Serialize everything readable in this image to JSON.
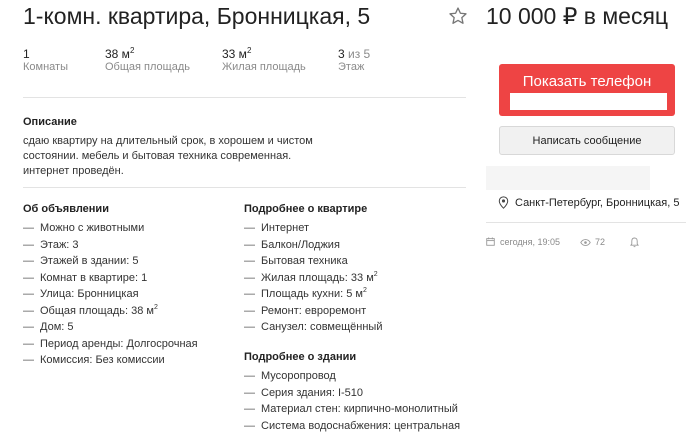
{
  "listing": {
    "title": "1-комн. квартира, Бронницкая, 5",
    "price": "10 000 ₽ в месяц"
  },
  "stats": [
    {
      "value": "1",
      "sup": "",
      "label": "Комнаты"
    },
    {
      "value": "38 м",
      "sup": "2",
      "label": "Общая площадь"
    },
    {
      "value": "33 м",
      "sup": "2",
      "label": "Жилая площадь"
    },
    {
      "value": "3",
      "value_suffix": " из 5",
      "label": "Этаж"
    }
  ],
  "description": {
    "heading": "Описание",
    "text": "сдаю квартиру на длительный срок, в хорошем и чистом состоянии. мебель и бытовая техника современная. интернет проведён."
  },
  "about_ad": {
    "heading": "Об объявлении",
    "items": [
      "Можно с животными",
      "Этаж: 3",
      "Этажей в здании: 5",
      "Комнат в квартире: 1",
      "Улица: Бронницкая",
      "Общая площадь: 38 м",
      "Дом: 5",
      "Период аренды: Долгосрочная",
      "Комиссия: Без комиссии"
    ],
    "sup_two": "2"
  },
  "about_flat": {
    "heading": "Подробнее о квартире",
    "items": [
      "Интернет",
      "Балкон/Лоджия",
      "Бытовая техника",
      "Жилая площадь: 33 м",
      "Площадь кухни: 5 м",
      "Ремонт: евроремонт",
      "Санузел: совмещённый"
    ],
    "sup_two": "2"
  },
  "about_building": {
    "heading": "Подробнее о здании",
    "items": [
      "Мусоропровод",
      "Серия здания: I-510",
      "Материал стен: кирпично-монолитный",
      "Система водоснабжения: центральная"
    ]
  },
  "contact": {
    "show_phone_label": "Показать телефон",
    "write_message_label": "Написать сообщение"
  },
  "location": {
    "address": "Санкт-Петербург, Бронницкая, 5"
  },
  "meta": {
    "date": "сегодня, 19:05",
    "views": "72"
  },
  "colors": {
    "accent": "#ee4444"
  },
  "icons": [
    "star-icon",
    "location-pin-icon",
    "calendar-icon",
    "eye-icon",
    "bell-icon"
  ]
}
